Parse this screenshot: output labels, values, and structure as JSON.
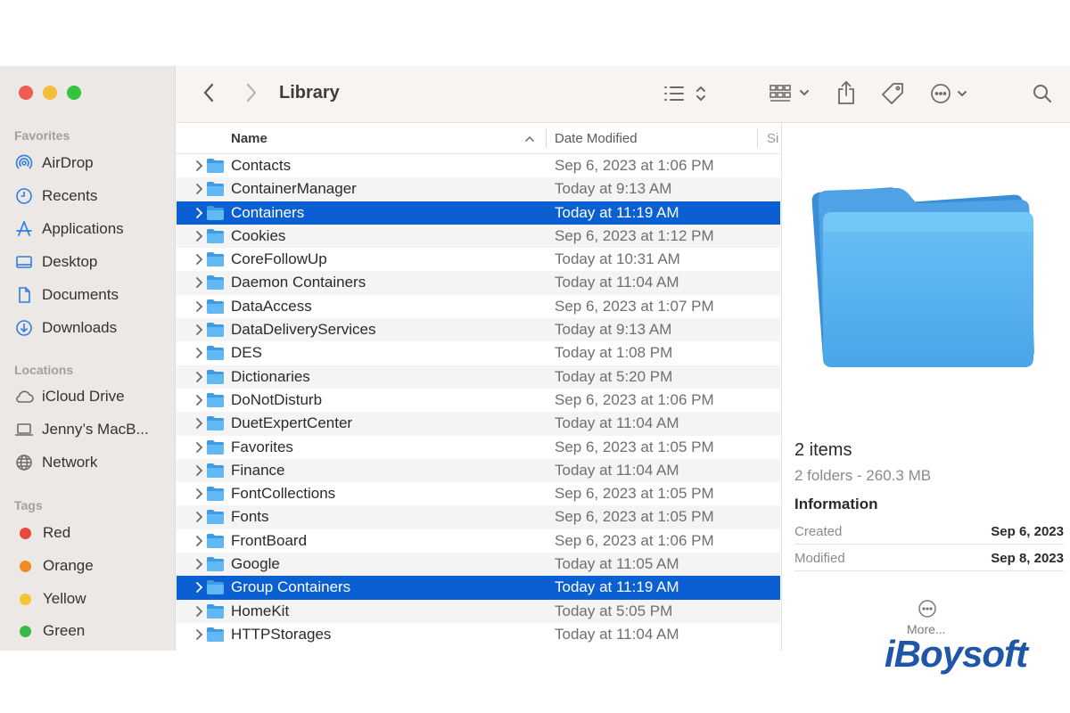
{
  "window": {
    "path_title": "Library"
  },
  "sidebar": {
    "favorites_title": "Favorites",
    "favorites": [
      {
        "label": "AirDrop",
        "icon": "airdrop-icon"
      },
      {
        "label": "Recents",
        "icon": "clock-icon"
      },
      {
        "label": "Applications",
        "icon": "applications-icon"
      },
      {
        "label": "Desktop",
        "icon": "desktop-icon"
      },
      {
        "label": "Documents",
        "icon": "document-icon"
      },
      {
        "label": "Downloads",
        "icon": "download-icon"
      }
    ],
    "locations_title": "Locations",
    "locations": [
      {
        "label": "iCloud Drive",
        "icon": "cloud-icon"
      },
      {
        "label": "Jenny’s MacB...",
        "icon": "laptop-icon"
      },
      {
        "label": "Network",
        "icon": "globe-icon"
      }
    ],
    "tags_title": "Tags",
    "tags": [
      {
        "label": "Red",
        "color": "#e8473e"
      },
      {
        "label": "Orange",
        "color": "#f08a24"
      },
      {
        "label": "Yellow",
        "color": "#f4c531"
      },
      {
        "label": "Green",
        "color": "#3ab84a"
      }
    ]
  },
  "list": {
    "col_name": "Name",
    "col_date": "Date Modified",
    "col_size": "Si",
    "rows": [
      {
        "name": "Contacts",
        "date": "Sep 6, 2023 at 1:06 PM",
        "selected": false
      },
      {
        "name": "ContainerManager",
        "date": "Today at 9:13 AM",
        "selected": false
      },
      {
        "name": "Containers",
        "date": "Today at 11:19 AM",
        "selected": true
      },
      {
        "name": "Cookies",
        "date": "Sep 6, 2023 at 1:12 PM",
        "selected": false
      },
      {
        "name": "CoreFollowUp",
        "date": "Today at 10:31 AM",
        "selected": false
      },
      {
        "name": "Daemon Containers",
        "date": "Today at 11:04 AM",
        "selected": false
      },
      {
        "name": "DataAccess",
        "date": "Sep 6, 2023 at 1:07 PM",
        "selected": false
      },
      {
        "name": "DataDeliveryServices",
        "date": "Today at 9:13 AM",
        "selected": false
      },
      {
        "name": "DES",
        "date": "Today at 1:08 PM",
        "selected": false
      },
      {
        "name": "Dictionaries",
        "date": "Today at 5:20 PM",
        "selected": false
      },
      {
        "name": "DoNotDisturb",
        "date": "Sep 6, 2023 at 1:06 PM",
        "selected": false
      },
      {
        "name": "DuetExpertCenter",
        "date": "Today at 11:04 AM",
        "selected": false
      },
      {
        "name": "Favorites",
        "date": "Sep 6, 2023 at 1:05 PM",
        "selected": false
      },
      {
        "name": "Finance",
        "date": "Today at 11:04 AM",
        "selected": false
      },
      {
        "name": "FontCollections",
        "date": "Sep 6, 2023 at 1:05 PM",
        "selected": false
      },
      {
        "name": "Fonts",
        "date": "Sep 6, 2023 at 1:05 PM",
        "selected": false
      },
      {
        "name": "FrontBoard",
        "date": "Sep 6, 2023 at 1:06 PM",
        "selected": false
      },
      {
        "name": "Google",
        "date": "Today at 11:05 AM",
        "selected": false
      },
      {
        "name": "Group Containers",
        "date": "Today at 11:19 AM",
        "selected": true
      },
      {
        "name": "HomeKit",
        "date": "Today at 5:05 PM",
        "selected": false
      },
      {
        "name": "HTTPStorages",
        "date": "Today at 11:04 AM",
        "selected": false
      }
    ]
  },
  "preview": {
    "count": "2 items",
    "summary": "2 folders - 260.3 MB",
    "info_title": "Information",
    "created_label": "Created",
    "created_value": "Sep 6, 2023",
    "modified_label": "Modified",
    "modified_value": "Sep 8, 2023",
    "more_label": "More..."
  },
  "watermark": "iBoysoft",
  "colors": {
    "accent": "#0a5fd3",
    "folder": "#5cb4ef"
  }
}
